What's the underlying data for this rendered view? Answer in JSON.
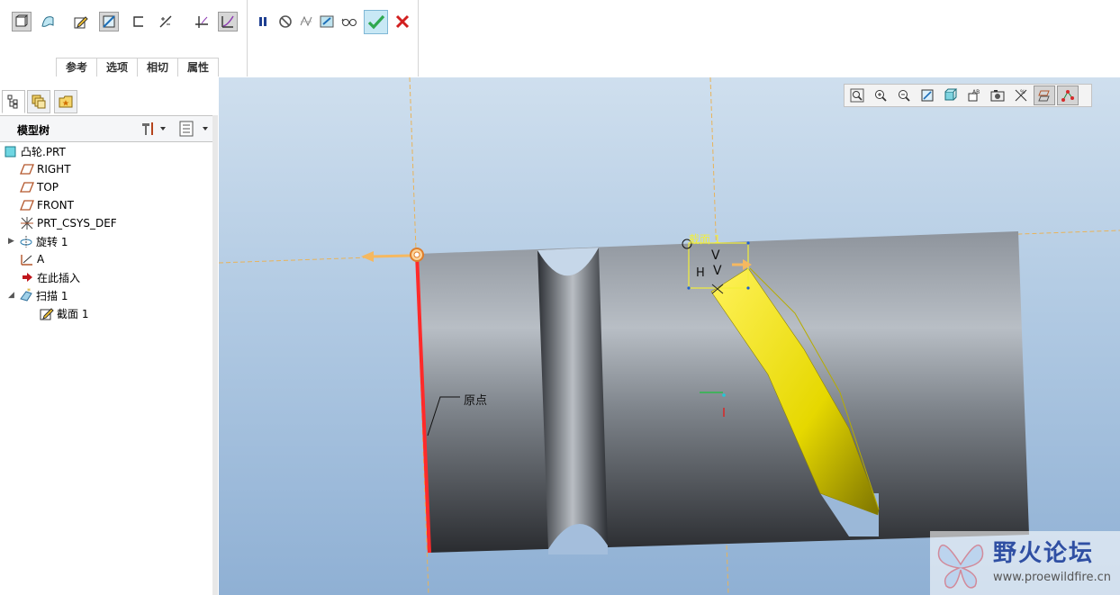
{
  "ribbon": {
    "tabs": [
      "参考",
      "选项",
      "相切",
      "属性"
    ],
    "buttons": [
      "solid-icon",
      "surface-icon",
      "sketch-edit-icon",
      "section-variable-icon",
      "open-end-icon",
      "merge-ends-icon",
      "normal-to-trajectory-icon",
      "constant-section-icon",
      "pause-icon",
      "no-preview-icon",
      "preview-geometry-icon",
      "verify-icon",
      "glasses-icon",
      "ok-icon",
      "cancel-icon"
    ],
    "ok_color": "#2fa84f",
    "cancel_color": "#d21f1f"
  },
  "panel_tabs": [
    "model-tree-tab",
    "folder-browser-tab",
    "favorites-tab"
  ],
  "tree": {
    "title": "模型树",
    "items": [
      {
        "label": "凸轮.PRT",
        "icon": "part-icon",
        "indent": 0
      },
      {
        "label": "RIGHT",
        "icon": "datum-plane-icon",
        "indent": 1
      },
      {
        "label": "TOP",
        "icon": "datum-plane-icon",
        "indent": 1
      },
      {
        "label": "FRONT",
        "icon": "datum-plane-icon",
        "indent": 1
      },
      {
        "label": "PRT_CSYS_DEF",
        "icon": "csys-icon",
        "indent": 1
      },
      {
        "label": "旋转 1",
        "icon": "revolve-icon",
        "indent": 1,
        "expander": "▶"
      },
      {
        "label": "A",
        "icon": "datum-axis-icon",
        "indent": 1
      },
      {
        "label": "在此插入",
        "icon": "insert-here-icon",
        "indent": 1
      },
      {
        "label": "扫描 1",
        "icon": "sweep-icon",
        "indent": 1,
        "expander": "◢"
      },
      {
        "label": "截面 1",
        "icon": "section-icon",
        "indent": 2
      }
    ]
  },
  "viewport": {
    "labels": {
      "origin": "原点",
      "section": "截面 1",
      "h": "H",
      "v": "V"
    },
    "view_tools": [
      "refit-icon",
      "zoom-in-icon",
      "zoom-out-icon",
      "repaint-icon",
      "display-style-icon",
      "saved-views-icon",
      "view-manager-icon",
      "annotation-display-icon",
      "plane-display-icon",
      "point-display-icon"
    ]
  },
  "watermark": {
    "title": "野火论坛",
    "url": "www.proewildfire.cn"
  }
}
